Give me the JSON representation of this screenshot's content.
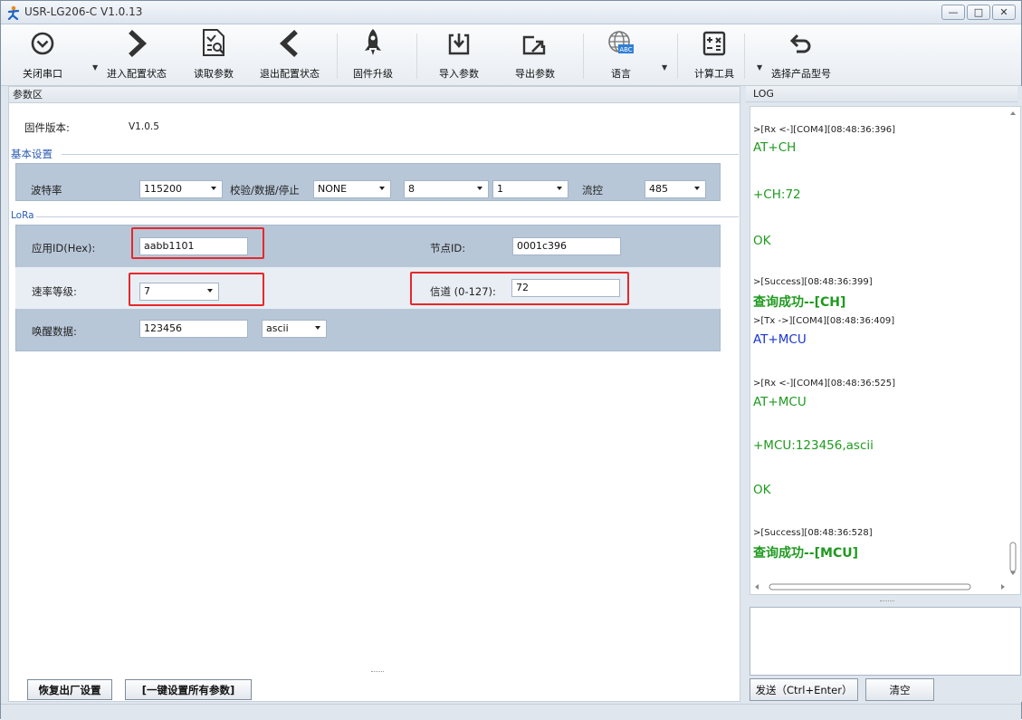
{
  "window": {
    "title": "USR-LG206-C  V1.0.13",
    "controls": {
      "minimize": "—",
      "maximize": "□",
      "close": "✕"
    }
  },
  "toolbar": {
    "items": [
      {
        "label": "关闭串口",
        "icon": "chevron-circle-down-icon"
      },
      {
        "label": "进入配置状态",
        "icon": "chevron-right-icon"
      },
      {
        "label": "读取参数",
        "icon": "read-doc-search-icon"
      },
      {
        "label": "退出配置状态",
        "icon": "chevron-left-icon"
      },
      {
        "label": "固件升级",
        "icon": "rocket-icon"
      },
      {
        "label": "导入参数",
        "icon": "import-icon"
      },
      {
        "label": "导出参数",
        "icon": "export-icon"
      },
      {
        "label": "语言",
        "icon": "globe-abc-icon"
      },
      {
        "label": "计算工具",
        "icon": "calculator-icon"
      },
      {
        "label": "选择产品型号",
        "icon": "undo-arrow-icon"
      }
    ]
  },
  "params": {
    "header": "参数区",
    "firmware_label": "固件版本:",
    "firmware_value": "V1.0.5",
    "basic_header": "基本设置",
    "baud_label": "波特率",
    "baud_value": "115200",
    "parity_label": "校验/数据/停止",
    "parity_value": "NONE",
    "data_bits": "8",
    "stop_bits": "1",
    "flow_label": "流控",
    "flow_value": "485",
    "lora_header": "LoRa",
    "appid_label": "应用ID(Hex):",
    "appid_value": "aabb1101",
    "node_label": "节点ID:",
    "node_value": "0001c396",
    "rate_label": "速率等级:",
    "rate_value": "7",
    "channel_label": "信道 (0-127):",
    "channel_value": "72",
    "wake_label": "唤醒数据:",
    "wake_value": "123456",
    "wake_format": "ascii"
  },
  "bottom_buttons": {
    "restore": "恢复出厂设置",
    "set_all": "[一键设置所有参数]"
  },
  "log": {
    "header": "LOG",
    "lines": [
      {
        "type": "meta",
        "text": ">[Rx <-][COM4][08:48:36:396]"
      },
      {
        "type": "green",
        "text": "AT+CH"
      },
      {
        "type": "green",
        "text": "+CH:72"
      },
      {
        "type": "green",
        "text": "OK"
      },
      {
        "type": "meta",
        "text": ">[Success][08:48:36:399]"
      },
      {
        "type": "greenbold",
        "text": "查询成功--[CH]"
      },
      {
        "type": "meta",
        "text": ">[Tx ->][COM4][08:48:36:409]"
      },
      {
        "type": "blue",
        "text": "AT+MCU"
      },
      {
        "type": "meta",
        "text": ">[Rx <-][COM4][08:48:36:525]"
      },
      {
        "type": "green",
        "text": "AT+MCU"
      },
      {
        "type": "green",
        "text": "+MCU:123456,ascii"
      },
      {
        "type": "green",
        "text": "OK"
      },
      {
        "type": "meta",
        "text": ">[Success][08:48:36:528]"
      },
      {
        "type": "greenbold",
        "text": "查询成功--[MCU]"
      }
    ],
    "send_button": "发送（Ctrl+Enter）",
    "clear_button": "清空"
  },
  "colors": {
    "log_green": "#1f9a1f",
    "log_blue": "#1a34d0",
    "highlight_red": "#e6282b",
    "section_blue": "#2a5bb5"
  }
}
